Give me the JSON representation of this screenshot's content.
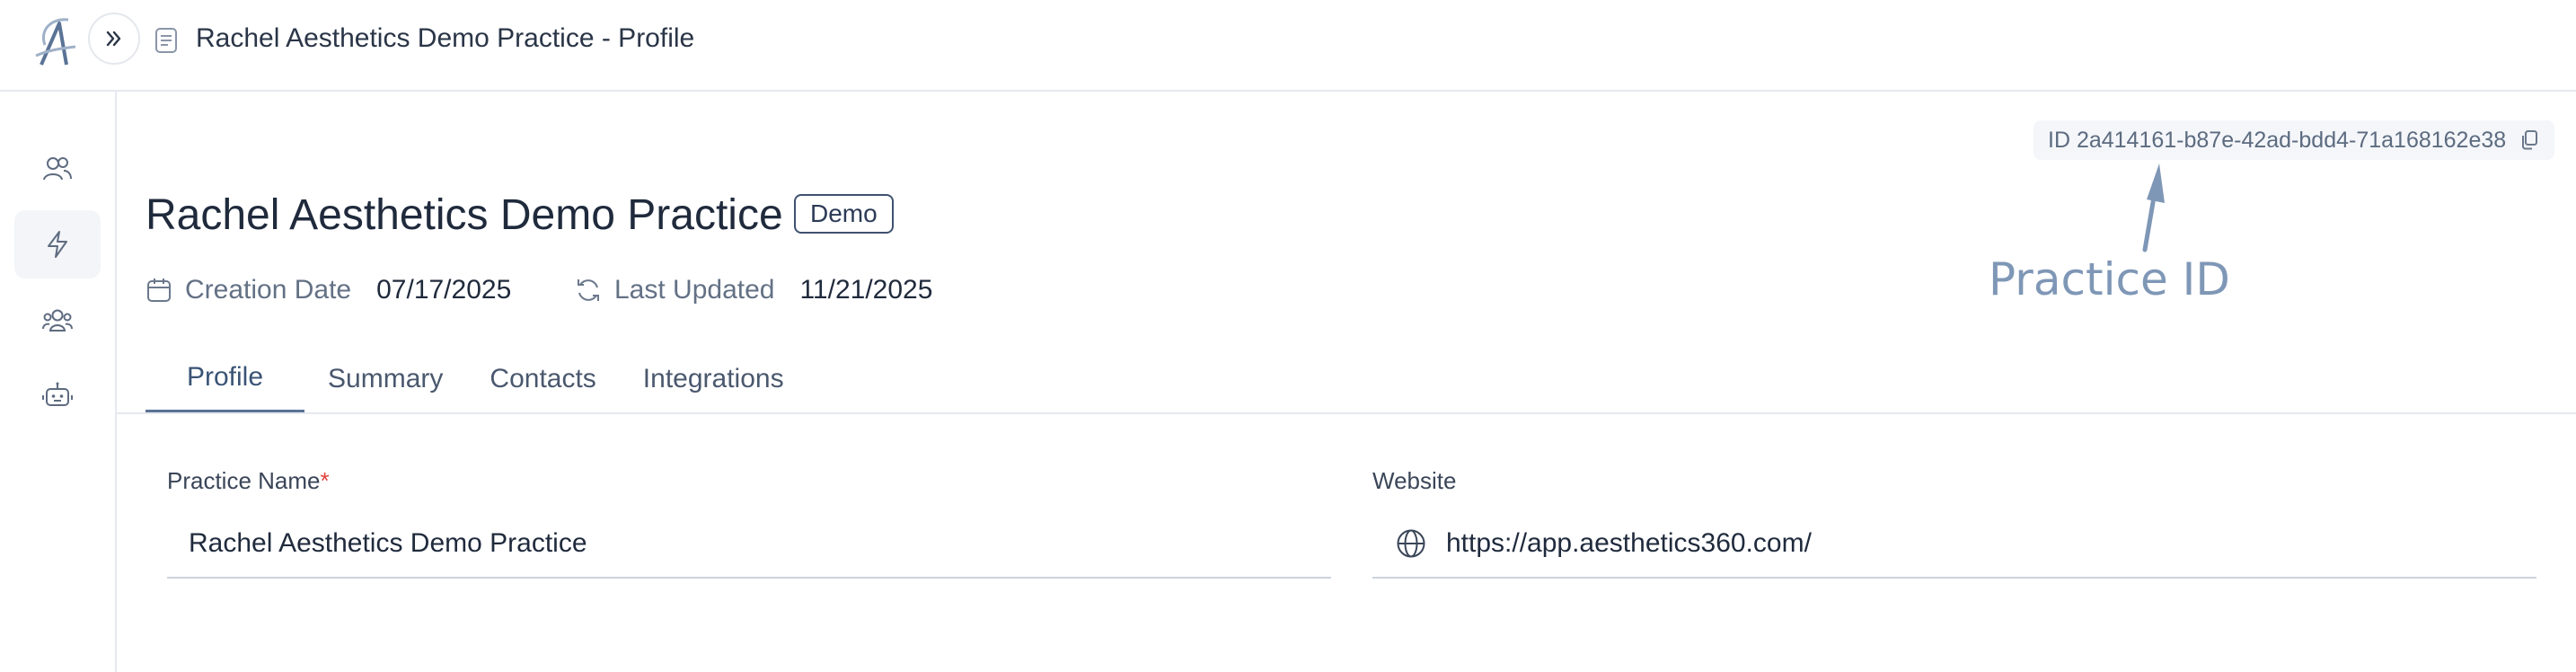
{
  "header": {
    "title": "Rachel Aesthetics Demo Practice - Profile"
  },
  "sidebar": {
    "items": [
      {
        "icon": "users-icon",
        "active": false
      },
      {
        "icon": "lightning-icon",
        "active": true
      },
      {
        "icon": "team-icon",
        "active": false
      },
      {
        "icon": "robot-icon",
        "active": false
      }
    ]
  },
  "practice": {
    "id_text": "ID 2a414161-b87e-42ad-bdd4-71a168162e38",
    "name": "Rachel Aesthetics Demo Practice",
    "badge": "Demo",
    "creation_label": "Creation Date",
    "creation_value": "07/17/2025",
    "updated_label": "Last Updated",
    "updated_value": "11/21/2025"
  },
  "annotation": {
    "label": "Practice ID",
    "color": "#7f97b6"
  },
  "tabs": [
    {
      "label": "Profile",
      "active": true
    },
    {
      "label": "Summary",
      "active": false
    },
    {
      "label": "Contacts",
      "active": false
    },
    {
      "label": "Integrations",
      "active": false
    }
  ],
  "form": {
    "practice_name_label": "Practice Name",
    "required_mark": "*",
    "practice_name_value": "Rachel Aesthetics Demo Practice",
    "website_label": "Website",
    "website_value": "https://app.aesthetics360.com/"
  },
  "colors": {
    "accent": "#5a7396",
    "required": "#e0403a",
    "border": "#e6e9ef"
  }
}
